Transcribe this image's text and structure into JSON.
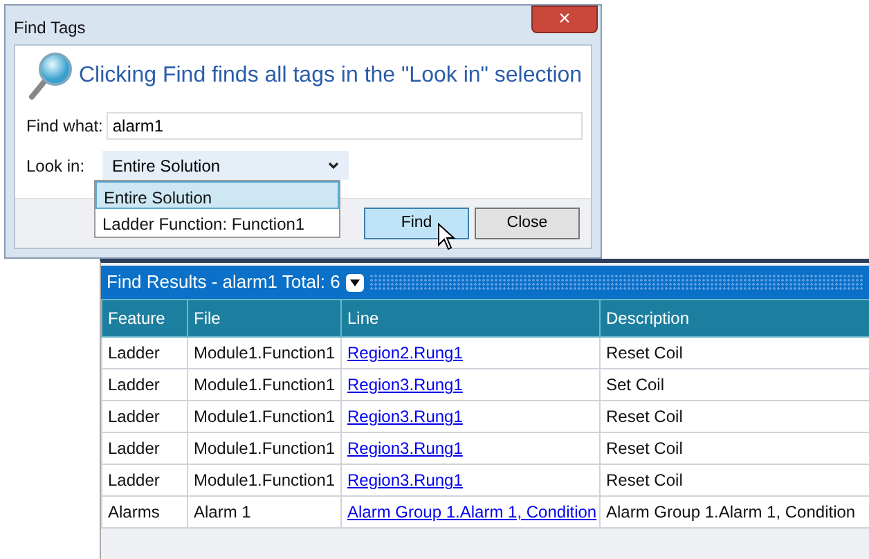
{
  "dialog": {
    "title": "Find Tags",
    "close_glyph": "×",
    "message": "Clicking Find finds all tags in the \"Look in\" selection",
    "find_what": {
      "label": "Find what:",
      "value": "alarm1"
    },
    "look_in": {
      "label": "Look in:",
      "value": "Entire Solution",
      "expanded": true,
      "options": [
        {
          "label": "Entire Solution",
          "selected": true
        },
        {
          "label": "Ladder Function: Function1",
          "selected": false
        }
      ]
    },
    "buttons": [
      {
        "label": "Find",
        "hovered": true
      },
      {
        "label": "Close",
        "hovered": false
      }
    ]
  },
  "results": {
    "title": "Find Results - alarm1 Total: 6",
    "columns": [
      "Feature",
      "File",
      "Line",
      "Description"
    ],
    "rows": [
      [
        "Ladder",
        "Module1.Function1",
        "Region2.Rung1",
        "Reset Coil"
      ],
      [
        "Ladder",
        "Module1.Function1",
        "Region3.Rung1",
        "Set Coil"
      ],
      [
        "Ladder",
        "Module1.Function1",
        "Region3.Rung1",
        "Reset Coil"
      ],
      [
        "Ladder",
        "Module1.Function1",
        "Region3.Rung1",
        "Reset Coil"
      ],
      [
        "Ladder",
        "Module1.Function1",
        "Region3.Rung1",
        "Reset Coil"
      ],
      [
        "Alarms",
        "Alarm 1",
        "Alarm Group 1.Alarm 1, Condition",
        "Alarm Group 1.Alarm 1, Condition"
      ]
    ]
  }
}
